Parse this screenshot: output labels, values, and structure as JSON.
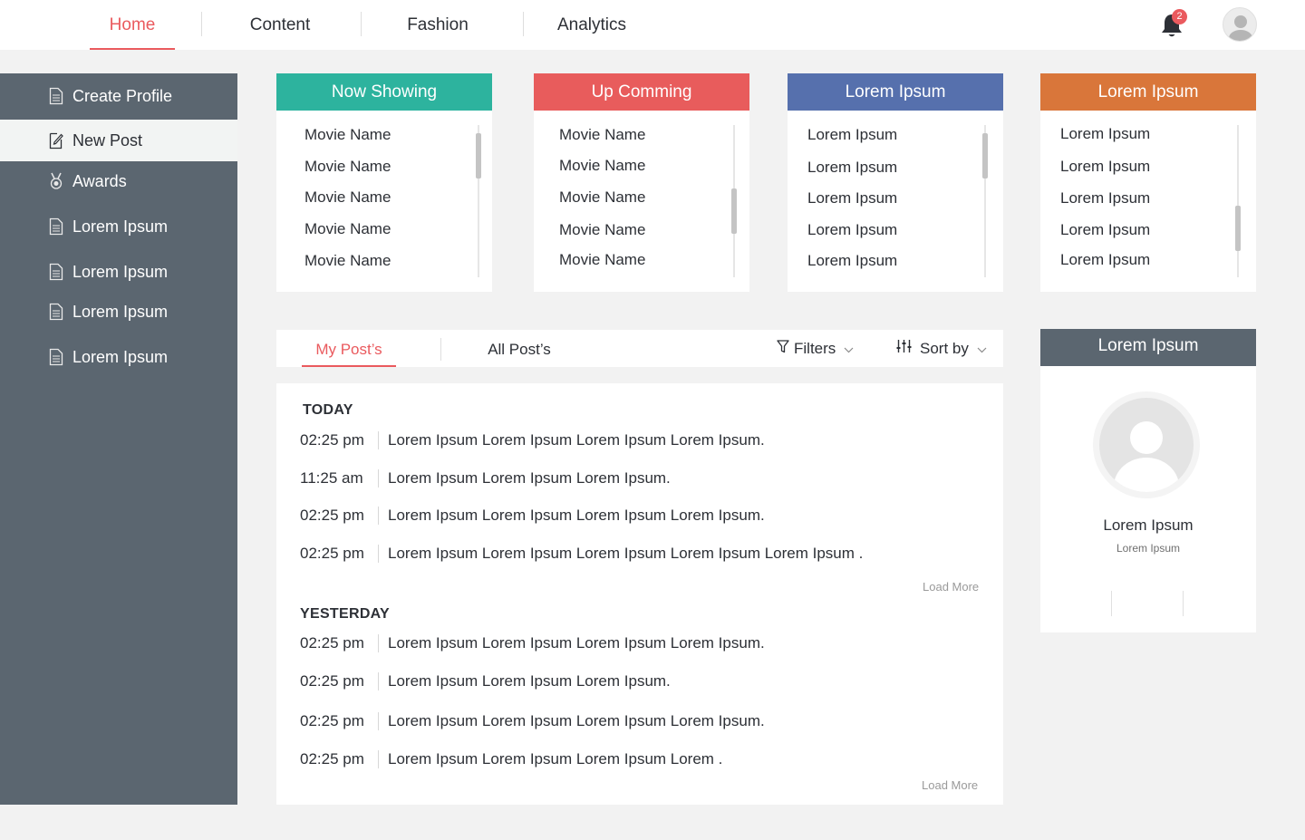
{
  "nav": {
    "tabs": [
      {
        "label": "Home",
        "active": true
      },
      {
        "label": "Content"
      },
      {
        "label": "Fashion"
      },
      {
        "label": "Analytics"
      }
    ],
    "notification_count": "2",
    "bell_icon": "bell-icon",
    "avatar_icon": "user-avatar-icon"
  },
  "sidebar": {
    "items": [
      {
        "label": "Create Profile",
        "icon": "document-icon"
      },
      {
        "label": "New Post",
        "icon": "edit-icon",
        "active": true
      },
      {
        "label": "Awards",
        "icon": "medal-icon"
      },
      {
        "label": "Lorem Ipsum",
        "icon": "document-icon"
      },
      {
        "label": "Lorem Ipsum",
        "icon": "document-icon"
      },
      {
        "label": "Lorem Ipsum",
        "icon": "document-icon"
      },
      {
        "label": "Lorem Ipsum",
        "icon": "document-icon"
      }
    ]
  },
  "cards": [
    {
      "title": "Now Showing",
      "color": "#2db39e",
      "items": [
        "Movie Name",
        "Movie Name",
        "Movie Name",
        "Movie Name",
        "Movie Name"
      ]
    },
    {
      "title": "Up Comming",
      "color": "#e85c5c",
      "items": [
        "Movie Name",
        "Movie Name",
        "Movie Name",
        "Movie Name",
        "Movie Name"
      ]
    },
    {
      "title": "Lorem Ipsum",
      "color": "#5670ad",
      "items": [
        "Lorem Ipsum",
        "Lorem Ipsum",
        "Lorem Ipsum",
        "Lorem Ipsum",
        "Lorem Ipsum"
      ]
    },
    {
      "title": "Lorem Ipsum",
      "color": "#d9763a",
      "items": [
        "Lorem Ipsum",
        "Lorem Ipsum",
        "Lorem Ipsum",
        "Lorem Ipsum",
        "Lorem Ipsum"
      ]
    }
  ],
  "posts_tabs": {
    "my_posts": "My Post’s",
    "all_posts": "All Post’s",
    "filters": "Filters",
    "sort_by": "Sort by"
  },
  "posts": {
    "today": {
      "heading": "TODAY",
      "rows": [
        {
          "time": "02:25 pm",
          "text": "Lorem Ipsum Lorem Ipsum Lorem Ipsum Lorem Ipsum."
        },
        {
          "time": "11:25 am",
          "text": "Lorem Ipsum Lorem Ipsum Lorem Ipsum."
        },
        {
          "time": "02:25 pm",
          "text": "Lorem Ipsum Lorem Ipsum Lorem Ipsum Lorem Ipsum."
        },
        {
          "time": "02:25 pm",
          "text": "Lorem Ipsum Lorem Ipsum Lorem Ipsum Lorem Ipsum Lorem Ipsum ."
        }
      ],
      "load_more": "Load More"
    },
    "yesterday": {
      "heading": "YESTERDAY",
      "rows": [
        {
          "time": "02:25 pm",
          "text": "Lorem Ipsum Lorem Ipsum Lorem Ipsum Lorem Ipsum."
        },
        {
          "time": "02:25 pm",
          "text": "Lorem Ipsum Lorem Ipsum Lorem Ipsum."
        },
        {
          "time": "02:25 pm",
          "text": "Lorem Ipsum Lorem Ipsum Lorem Ipsum Lorem Ipsum."
        },
        {
          "time": "02:25 pm",
          "text": "Lorem Ipsum Lorem Ipsum Lorem Ipsum Lorem ."
        }
      ],
      "load_more": "Load More"
    }
  },
  "profile": {
    "title": "Lorem Ipsum",
    "name": "Lorem Ipsum",
    "subtitle": "Lorem Ipsum",
    "avatar_icon": "user-avatar-icon"
  },
  "colors": {
    "accent": "#ea5a5e",
    "sidebar": "#5b6670",
    "background": "#f2f2f2"
  }
}
